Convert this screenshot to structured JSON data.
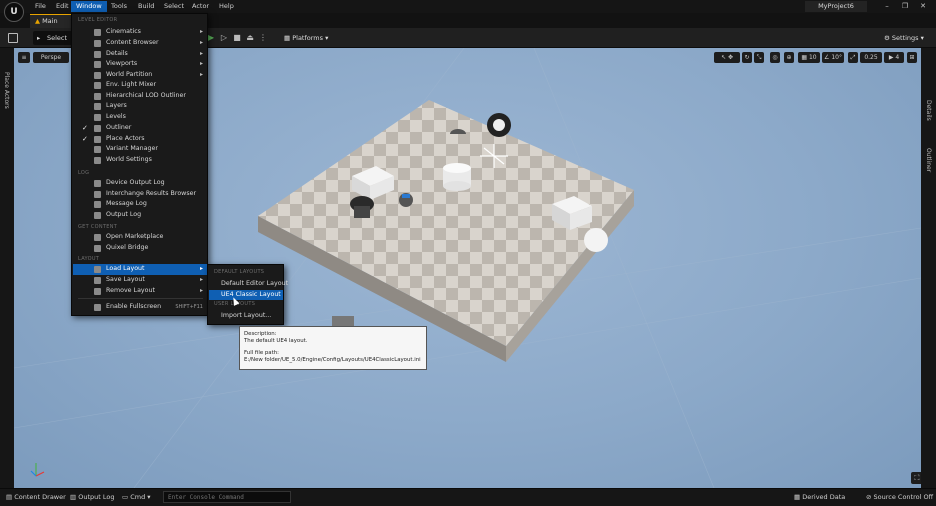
{
  "menubar": {
    "items": [
      "File",
      "Edit",
      "Window",
      "Tools",
      "Build",
      "Select",
      "Actor",
      "Help"
    ],
    "active": "Window",
    "project_name": "MyProject6"
  },
  "tab": {
    "label": "Main"
  },
  "toolbar": {
    "select_mode": "Select M",
    "platforms": "Platforms",
    "settings": "Settings"
  },
  "left_panel": {
    "label": "Place Actors"
  },
  "right_panel": {
    "details": "Details",
    "outliner": "Outliner"
  },
  "viewport": {
    "perspective": "Perspe",
    "grid_size": "10",
    "angle": "10°",
    "scale": "0.25",
    "camera_speed": "4"
  },
  "window_menu": {
    "sections": [
      {
        "header": "LEVEL EDITOR",
        "items": [
          {
            "label": "Cinematics",
            "submenu": true,
            "checked": false
          },
          {
            "label": "Content Browser",
            "submenu": true,
            "checked": false
          },
          {
            "label": "Details",
            "submenu": true,
            "checked": false
          },
          {
            "label": "Viewports",
            "submenu": true,
            "checked": false
          },
          {
            "label": "World Partition",
            "submenu": true,
            "checked": false
          },
          {
            "label": "Env. Light Mixer",
            "submenu": false,
            "checked": false
          },
          {
            "label": "Hierarchical LOD Outliner",
            "submenu": false,
            "checked": false
          },
          {
            "label": "Layers",
            "submenu": false,
            "checked": false
          },
          {
            "label": "Levels",
            "submenu": false,
            "checked": false
          },
          {
            "label": "Outliner",
            "submenu": false,
            "checked": true
          },
          {
            "label": "Place Actors",
            "submenu": false,
            "checked": true
          },
          {
            "label": "Variant Manager",
            "submenu": false,
            "checked": false
          },
          {
            "label": "World Settings",
            "submenu": false,
            "checked": false
          }
        ]
      },
      {
        "header": "LOG",
        "items": [
          {
            "label": "Device Output Log",
            "submenu": false,
            "checked": false
          },
          {
            "label": "Interchange Results Browser",
            "submenu": false,
            "checked": false
          },
          {
            "label": "Message Log",
            "submenu": false,
            "checked": false
          },
          {
            "label": "Output Log",
            "submenu": false,
            "checked": false
          }
        ]
      },
      {
        "header": "GET CONTENT",
        "items": [
          {
            "label": "Open Marketplace",
            "submenu": false,
            "checked": false
          },
          {
            "label": "Quixel Bridge",
            "submenu": false,
            "checked": false
          }
        ]
      },
      {
        "header": "LAYOUT",
        "items": [
          {
            "label": "Load Layout",
            "submenu": true,
            "checked": false,
            "highlighted": true
          },
          {
            "label": "Save Layout",
            "submenu": true,
            "checked": false
          },
          {
            "label": "Remove Layout",
            "submenu": true,
            "checked": false
          }
        ]
      }
    ],
    "fullscreen": {
      "label": "Enable Fullscreen",
      "shortcut": "SHIFT+F11"
    }
  },
  "load_layout_submenu": {
    "default_header": "DEFAULT LAYOUTS",
    "default_items": [
      "Default Editor Layout",
      "UE4 Classic Layout"
    ],
    "highlighted": "UE4 Classic Layout",
    "user_header": "USER LAYOUTS",
    "user_items": [
      "Import Layout..."
    ]
  },
  "tooltip": {
    "desc_label": "Description:",
    "desc": "The default UE4 layout.",
    "path_label": "Full file path:",
    "path": "E:/New folder/UE_5.0/Engine/Config/Layouts/UE4ClassicLayout.ini"
  },
  "statusbar": {
    "content_drawer": "Content Drawer",
    "output_log": "Output Log",
    "cmd": "Cmd",
    "console_placeholder": "Enter Console Command",
    "derived_data": "Derived Data",
    "source_control": "Source Control Off"
  },
  "colors": {
    "accent": "#0f5fb3",
    "tab_accent": "#e8a400",
    "viewport_sky": "#8ca9c9"
  }
}
